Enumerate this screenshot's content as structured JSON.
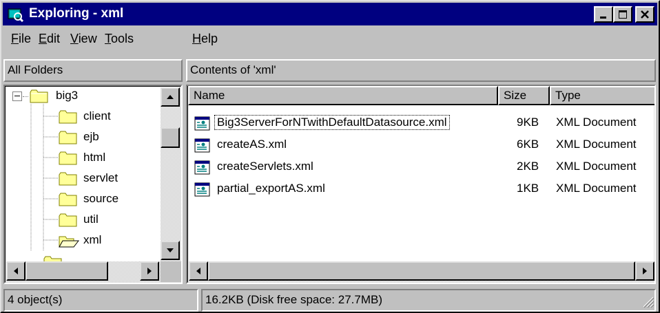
{
  "window": {
    "title": "Exploring - xml",
    "icon": "explorer-icon"
  },
  "menu": [
    {
      "label": "File",
      "key": "F",
      "rest": "ile"
    },
    {
      "label": "Edit",
      "key": "E",
      "rest": "dit"
    },
    {
      "label": "View",
      "key": "V",
      "rest": "iew"
    },
    {
      "label": "Tools",
      "key": "T",
      "rest": "ools"
    },
    {
      "label": "Help",
      "key": "H",
      "rest": "elp"
    }
  ],
  "panes": {
    "left_header": "All Folders",
    "right_header": "Contents of 'xml'"
  },
  "tree": {
    "root": "big3",
    "children": [
      "client",
      "ejb",
      "html",
      "servlet",
      "source",
      "util",
      "xml"
    ],
    "selected": "xml"
  },
  "columns": {
    "name": "Name",
    "size": "Size",
    "type": "Type"
  },
  "files": [
    {
      "name": "Big3ServerForNTwithDefaultDatasource.xml",
      "size": "9KB",
      "type": "XML Document",
      "icon": "xml-document-icon"
    },
    {
      "name": "createAS.xml",
      "size": "6KB",
      "type": "XML Document",
      "icon": "xml-document-icon"
    },
    {
      "name": "createServlets.xml",
      "size": "2KB",
      "type": "XML Document",
      "icon": "xml-document-icon"
    },
    {
      "name": "partial_exportAS.xml",
      "size": "1KB",
      "type": "XML Document",
      "icon": "xml-document-icon"
    }
  ],
  "status": {
    "count": "4 object(s)",
    "disk": "16.2KB (Disk free space: 27.7MB)"
  },
  "colors": {
    "titlebar": "#000080",
    "face": "#c0c0c0",
    "folder": "#ffff99"
  }
}
